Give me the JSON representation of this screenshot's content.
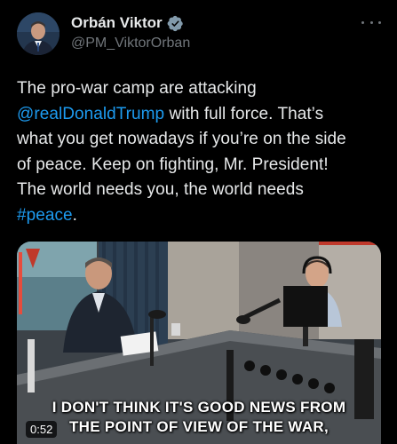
{
  "author": {
    "display_name": "Orbán Viktor",
    "handle": "@PM_ViktorOrban",
    "verified": true,
    "verified_icon": "verified-badge-icon"
  },
  "more_icon": "more-options-icon",
  "tweet": {
    "line1": "The pro-war camp are attacking",
    "mention": "@realDonaldTrump",
    "line2_rest": " with full force. That’s",
    "line3": "what you get nowadays if you’re on the side",
    "line4": "of peace. Keep on fighting, Mr. President!",
    "line5": "The world needs you, the world needs",
    "hashtag": "#peace",
    "line6_rest": "."
  },
  "video": {
    "caption_line1": "I DON'T THINK IT'S GOOD NEWS FROM",
    "caption_line2": "THE POINT OF VIEW OF THE WAR,",
    "duration": "0:52"
  },
  "colors": {
    "background": "#000000",
    "text": "#e7e9ea",
    "secondary": "#71767b",
    "link": "#1d9bf0",
    "verified": "#829aab"
  }
}
